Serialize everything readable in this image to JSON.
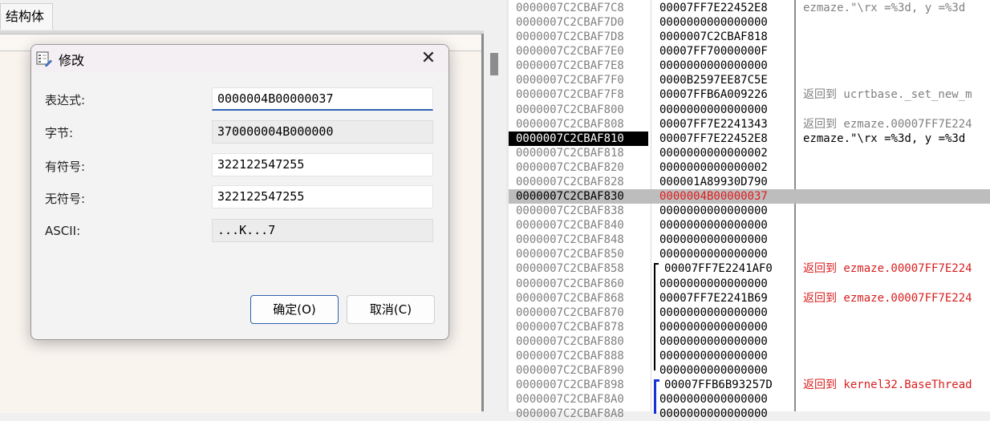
{
  "left_tab": {
    "label": "结构体"
  },
  "dialog": {
    "title": "修改",
    "fields": [
      {
        "label": "表达式:",
        "value": "0000004B00000037"
      },
      {
        "label": "字节:",
        "value": "370000004B000000"
      },
      {
        "label": "有符号:",
        "value": "322122547255"
      },
      {
        "label": "无符号:",
        "value": "322122547255"
      },
      {
        "label": "ASCII:",
        "value": "...K...7"
      }
    ],
    "ok_label": "确定(O)",
    "cancel_label": "取消(C)"
  },
  "stack": {
    "rows": [
      {
        "addr": "0000007C2CBAF7C8",
        "value": "00007FF7E22452E8",
        "comment": "ezmaze.\"\\rx =%3d, y =%3d"
      },
      {
        "addr": "0000007C2CBAF7D0",
        "value": "0000000000000000",
        "comment": ""
      },
      {
        "addr": "0000007C2CBAF7D8",
        "value": "0000007C2CBAF818",
        "comment": ""
      },
      {
        "addr": "0000007C2CBAF7E0",
        "value": "00007FF70000000F",
        "comment": ""
      },
      {
        "addr": "0000007C2CBAF7E8",
        "value": "0000000000000000",
        "comment": ""
      },
      {
        "addr": "0000007C2CBAF7F0",
        "value": "0000B2597EE87C5E",
        "comment": ""
      },
      {
        "addr": "0000007C2CBAF7F8",
        "value": "00007FFB6A009226",
        "comment": "返回到 ucrtbase._set_new_m"
      },
      {
        "addr": "0000007C2CBAF800",
        "value": "0000000000000000",
        "comment": ""
      },
      {
        "addr": "0000007C2CBAF808",
        "value": "00007FF7E2241343",
        "comment": "返回到 ezmaze.00007FF7E224"
      },
      {
        "addr": "0000007C2CBAF810",
        "value": "00007FF7E22452E8",
        "comment": "ezmaze.\"\\rx =%3d, y =%3d"
      },
      {
        "addr": "0000007C2CBAF818",
        "value": "0000000000000002",
        "comment": ""
      },
      {
        "addr": "0000007C2CBAF820",
        "value": "0000000000000002",
        "comment": ""
      },
      {
        "addr": "0000007C2CBAF828",
        "value": "000001A89930D790",
        "comment": ""
      },
      {
        "addr": "0000007C2CBAF830",
        "value": "0000004B00000037",
        "comment": ""
      },
      {
        "addr": "0000007C2CBAF838",
        "value": "0000000000000000",
        "comment": ""
      },
      {
        "addr": "0000007C2CBAF840",
        "value": "0000000000000000",
        "comment": ""
      },
      {
        "addr": "0000007C2CBAF848",
        "value": "0000000000000000",
        "comment": ""
      },
      {
        "addr": "0000007C2CBAF850",
        "value": "0000000000000000",
        "comment": ""
      },
      {
        "addr": "0000007C2CBAF858",
        "value": "00007FF7E2241AF0",
        "comment": "返回到 ezmaze.00007FF7E224"
      },
      {
        "addr": "0000007C2CBAF860",
        "value": "0000000000000000",
        "comment": ""
      },
      {
        "addr": "0000007C2CBAF868",
        "value": "00007FF7E2241B69",
        "comment": "返回到 ezmaze.00007FF7E224"
      },
      {
        "addr": "0000007C2CBAF870",
        "value": "0000000000000000",
        "comment": ""
      },
      {
        "addr": "0000007C2CBAF878",
        "value": "0000000000000000",
        "comment": ""
      },
      {
        "addr": "0000007C2CBAF880",
        "value": "0000000000000000",
        "comment": ""
      },
      {
        "addr": "0000007C2CBAF888",
        "value": "0000000000000000",
        "comment": ""
      },
      {
        "addr": "0000007C2CBAF890",
        "value": "0000000000000000",
        "comment": ""
      },
      {
        "addr": "0000007C2CBAF898",
        "value": "00007FFB6B93257D",
        "comment": "返回到 kernel32.BaseThread"
      },
      {
        "addr": "0000007C2CBAF8A0",
        "value": "0000000000000000",
        "comment": ""
      },
      {
        "addr": "0000007C2CBAF8A8",
        "value": "0000000000000000",
        "comment": ""
      }
    ]
  },
  "colors": {
    "accent": "#2e63b3",
    "return_red": "#d81e1e",
    "modified_red": "#e01b1b",
    "selected_row": "#bdbdbd",
    "current_addr_bg": "#000000",
    "call_bracket_black": "#000000",
    "call_bracket_blue": "#1633d8"
  }
}
